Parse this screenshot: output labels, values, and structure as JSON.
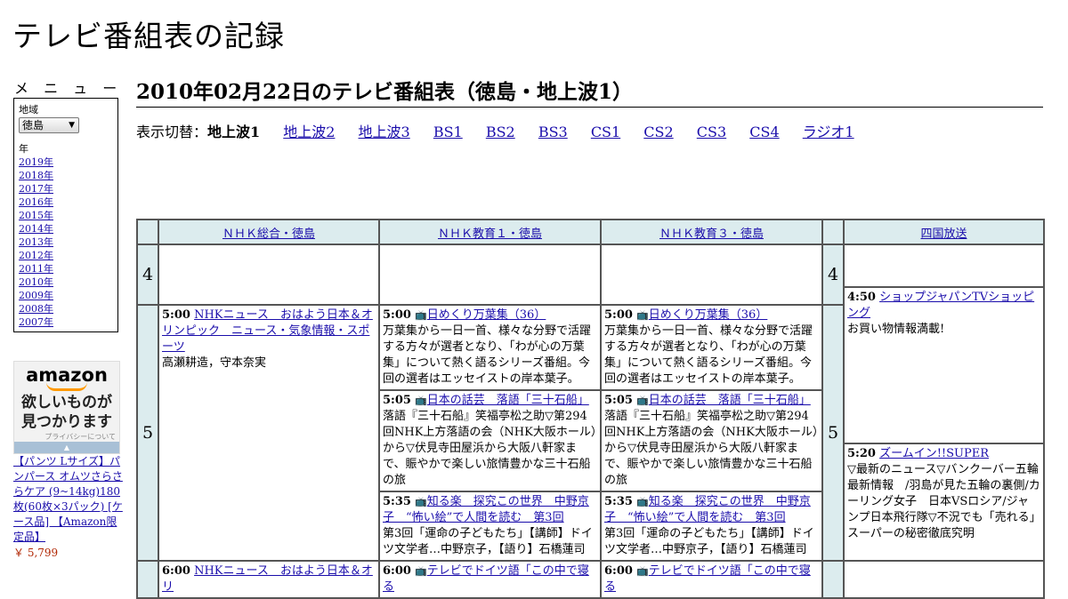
{
  "site": {
    "title": "テレビ番組表の記録"
  },
  "menu": {
    "heading": "メ ニ ュ ー",
    "region_label": "地域",
    "region_value": "徳島",
    "year_label": "年",
    "years": [
      "2019年",
      "2018年",
      "2017年",
      "2016年",
      "2015年",
      "2014年",
      "2013年",
      "2012年",
      "2011年",
      "2010年",
      "2009年",
      "2008年",
      "2007年"
    ]
  },
  "ad": {
    "logo": "amazon",
    "text_line1": "欲しいものが",
    "text_line2": "見つかります",
    "privacy": "プライバシーについて",
    "product": "【パンツ Lサイズ】パンパース オムツさらさらケア (9~14kg)180枚(60枚×3パック) [ケース品] 【Amazon限定品】",
    "price": "￥ 5,799"
  },
  "page": {
    "heading": "2010年02月22日のテレビ番組表（徳島・地上波1）"
  },
  "switcher": {
    "label": "表示切替：",
    "current": "地上波1",
    "links": [
      "地上波2",
      "地上波3",
      "BS1",
      "BS2",
      "BS3",
      "CS1",
      "CS2",
      "CS3",
      "CS4",
      "ラジオ1"
    ]
  },
  "grid": {
    "channels": [
      "ＮＨＫ総合・徳島",
      "ＮＨＫ教育１・徳島",
      "ＮＨＫ教育３・徳島",
      "四国放送"
    ],
    "hours": [
      "4",
      "5"
    ],
    "programs": {
      "nhk_sogo": [
        {
          "time": "5:00",
          "title": "NHKニュース　おはよう日本＆オリンピック　ニュース・気象情報・スポーツ",
          "desc": "高瀬耕造，守本奈実"
        },
        {
          "time": "6:00",
          "title": "NHKニュース　おはよう日本＆オリ",
          "desc": ""
        }
      ],
      "edu1": [
        {
          "time": "5:00",
          "icon": "📺",
          "title": "日めくり万葉集（36）",
          "desc": "万葉集から一日一首、様々な分野で活躍する方々が選者となり、「わが心の万葉集」について熱く語るシリーズ番組。今回の選者はエッセイストの岸本葉子。"
        },
        {
          "time": "5:05",
          "icon": "📺",
          "title": "日本の話芸　落語「三十石船」",
          "desc": "落語『三十石船』笑福亭松之助▽第294回NHK上方落語の会（NHK大阪ホール）から▽伏見寺田屋浜から大阪八軒家まで、賑やかで楽しい旅情豊かな三十石船の旅"
        },
        {
          "time": "5:35",
          "icon": "📺",
          "title": "知る楽　探究この世界　中野京子　“怖い絵”で人間を読む　第3回",
          "desc": "第3回「運命の子どもたち」【講師】ドイツ文学者…中野京子，【語り】石橋蓮司"
        },
        {
          "time": "6:00",
          "icon": "📺",
          "title": "テレビでドイツ語「この中で寝る",
          "desc": ""
        }
      ],
      "edu3": [
        {
          "time": "5:00",
          "icon": "📺",
          "title": "日めくり万葉集（36）",
          "desc": "万葉集から一日一首、様々な分野で活躍する方々が選者となり、「わが心の万葉集」について熱く語るシリーズ番組。今回の選者はエッセイストの岸本葉子。"
        },
        {
          "time": "5:05",
          "icon": "📺",
          "title": "日本の話芸　落語「三十石船」",
          "desc": "落語『三十石船』笑福亭松之助▽第294回NHK上方落語の会（NHK大阪ホール）から▽伏見寺田屋浜から大阪八軒家まで、賑やかで楽しい旅情豊かな三十石船の旅"
        },
        {
          "time": "5:35",
          "icon": "📺",
          "title": "知る楽　探究この世界　中野京子　“怖い絵”で人間を読む　第3回",
          "desc": "第3回「運命の子どもたち」【講師】ドイツ文学者…中野京子，【語り】石橋蓮司"
        },
        {
          "time": "6:00",
          "icon": "📺",
          "title": "テレビでドイツ語「この中で寝る",
          "desc": ""
        }
      ],
      "shikoku": [
        {
          "time": "4:50",
          "title": "ショップジャパンTVショッピング",
          "desc": "お買い物情報満載!"
        },
        {
          "time": "5:20",
          "title": "ズームイン!!SUPER",
          "desc": "▽最新のニュース▽バンクーバー五輪最新情報　/羽島が見た五輪の裏側/カーリング女子　日本VSロシア/ジャンプ日本飛行隊▽不況でも「売れる」スーパーの秘密徹底究明"
        }
      ]
    }
  }
}
